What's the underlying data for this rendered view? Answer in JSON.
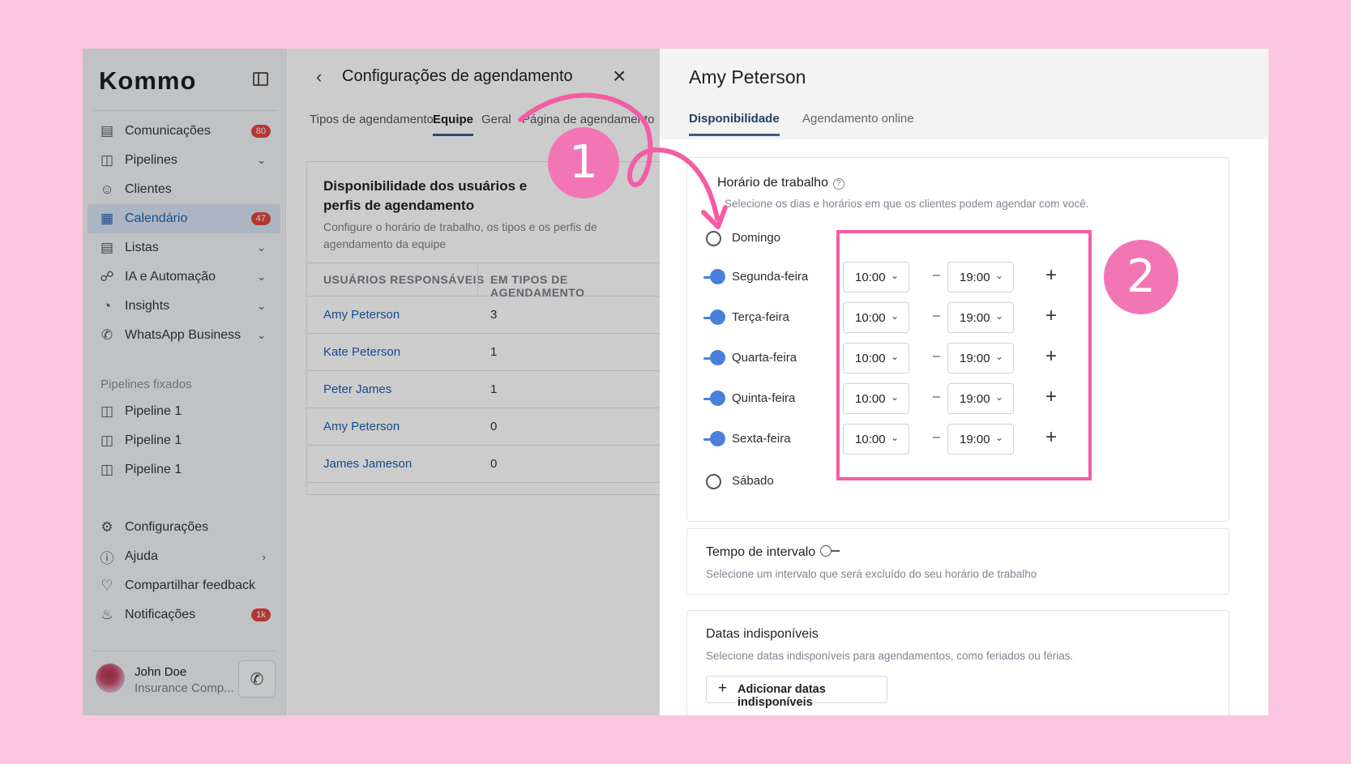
{
  "sidebar": {
    "logo": "Kommo",
    "items": [
      {
        "label": "Comunicações",
        "badge": "80",
        "icon": "chat-icon"
      },
      {
        "label": "Pipelines",
        "icon": "pipeline-icon",
        "chevron": true
      },
      {
        "label": "Clientes",
        "icon": "users-icon"
      },
      {
        "label": "Calendário",
        "badge": "47",
        "icon": "calendar-icon",
        "active": true
      },
      {
        "label": "Listas",
        "icon": "list-icon",
        "chevron": true
      },
      {
        "label": "IA e Automação",
        "icon": "automation-icon",
        "chevron": true
      },
      {
        "label": "Insights",
        "icon": "chart-icon",
        "chevron": true
      },
      {
        "label": "WhatsApp Business",
        "icon": "whatsapp-icon",
        "chevron": true
      }
    ],
    "pinned_header": "Pipelines fixados",
    "pinned": [
      "Pipeline 1",
      "Pipeline 1",
      "Pipeline 1"
    ],
    "bottom": [
      {
        "label": "Configurações",
        "icon": "gear-icon"
      },
      {
        "label": "Ajuda",
        "icon": "help-icon",
        "chevron": true
      },
      {
        "label": "Compartilhar feedback",
        "icon": "heart-icon"
      },
      {
        "label": "Notificações",
        "icon": "bell-icon",
        "badge": "1k"
      }
    ],
    "user": {
      "name": "John Doe",
      "company": "Insurance Comp..."
    }
  },
  "middle": {
    "title": "Configurações de agendamento",
    "tabs": [
      "Tipos de agendamento",
      "Equipe",
      "Geral",
      "Página de agendamento"
    ],
    "active_tab": "Equipe",
    "card_title": "Disponibilidade dos usuários e perfis de agendamento",
    "card_subtitle": "Configure o horário de trabalho, os tipos e os perfis de agendamento da equipe",
    "columns": [
      "USUÁRIOS RESPONSÁVEIS",
      "EM TIPOS DE AGENDAMENTO"
    ],
    "rows": [
      {
        "name": "Amy Peterson",
        "count": "3"
      },
      {
        "name": "Kate Peterson",
        "count": "1"
      },
      {
        "name": "Peter James",
        "count": "1"
      },
      {
        "name": "Amy Peterson",
        "count": "0"
      },
      {
        "name": "James Jameson",
        "count": "0"
      }
    ]
  },
  "right": {
    "title": "Amy Peterson",
    "tabs": [
      "Disponibilidade",
      "Agendamento online"
    ],
    "active_tab": "Disponibilidade",
    "working_hours": {
      "title": "Horário de trabalho",
      "subtitle": "Selecione os dias e horários em que os clientes podem agendar com você.",
      "days": [
        {
          "name": "Domingo",
          "enabled": false
        },
        {
          "name": "Segunda-feira",
          "enabled": true,
          "start": "10:00",
          "end": "19:00"
        },
        {
          "name": "Terça-feira",
          "enabled": true,
          "start": "10:00",
          "end": "19:00"
        },
        {
          "name": "Quarta-feira",
          "enabled": true,
          "start": "10:00",
          "end": "19:00"
        },
        {
          "name": "Quinta-feira",
          "enabled": true,
          "start": "10:00",
          "end": "19:00"
        },
        {
          "name": "Sexta-feira",
          "enabled": true,
          "start": "10:00",
          "end": "19:00"
        },
        {
          "name": "Sábado",
          "enabled": false
        }
      ]
    },
    "break": {
      "title": "Tempo de intervalo",
      "subtitle": "Selecione um intervalo que será excluído do seu horário de trabalho"
    },
    "unavailable": {
      "title": "Datas indisponíveis",
      "subtitle": "Selecione datas indisponíveis para agendamentos, como feriados ou férias.",
      "button": "Adicionar datas indisponíveis"
    }
  },
  "annotations": {
    "marker_1": "1",
    "marker_2": "2",
    "color": "#f45ca4"
  }
}
